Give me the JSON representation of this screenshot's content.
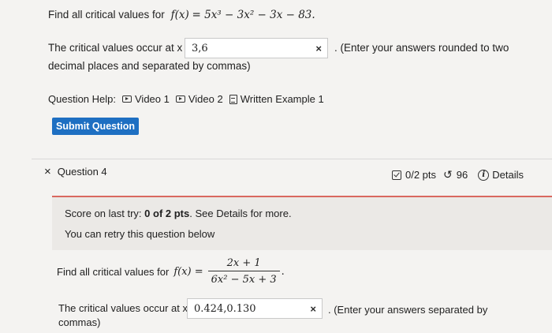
{
  "q3": {
    "prompt_prefix": "Find all critical values for",
    "function_lhs": "f(x)",
    "function_rhs": "5x³ − 3x² − 3x − 83.",
    "answer_label": "The critical values occur at x =",
    "answer_value": "3,6",
    "clear_glyph": "×",
    "hint_part1": ". (Enter your answers rounded to two",
    "hint_part2": "decimal places and separated by commas)",
    "help_label": "Question Help:",
    "help_links": [
      "Video 1",
      "Video 2",
      "Written Example 1"
    ],
    "submit_label": "Submit Question"
  },
  "q4": {
    "status_glyph": "×",
    "title": "Question 4",
    "score": "0/2 pts",
    "attempts": "96",
    "details_label": "Details",
    "score_text_prefix": "Score on last try:",
    "score_text_value": "0 of 2 pts",
    "score_text_suffix": ". See Details for more.",
    "retry_text": "You can retry this question below",
    "prompt_prefix": "Find all critical values for",
    "function_lhs": "f(x) =",
    "numerator": "2x + 1",
    "denominator": "6x² − 5x + 3",
    "answer_label": "The critical values occur at x =",
    "answer_value": "0.424,0.130",
    "clear_glyph": "×",
    "hint_part1": ". (Enter your answers separated by",
    "hint_part2": "commas)"
  },
  "colors": {
    "accent_blue": "#1e6fc2",
    "error_red": "#d9685f",
    "page_bg": "#f4f3f1",
    "panel_bg": "#ebe9e6"
  }
}
